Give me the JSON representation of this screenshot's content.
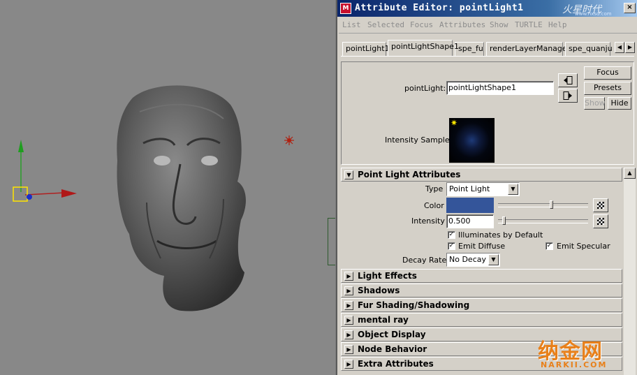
{
  "window": {
    "title": "Attribute Editor: pointLight1",
    "watermark_top": "火星时代",
    "watermark_top_sub": "www.hxsd.com",
    "close_label": "×"
  },
  "menu": [
    "List",
    "Selected",
    "Focus",
    "Attributes",
    "Show",
    "TURTLE",
    "Help"
  ],
  "tabs": [
    "pointLight1",
    "pointLightShape1",
    "spe_fu",
    "renderLayerManager",
    "spe_quanju"
  ],
  "active_tab": "pointLightShape1",
  "tab_scroll": {
    "left": "◀",
    "right": "▶"
  },
  "header": {
    "node_label": "pointLight:",
    "node_value": "pointLightShape1",
    "buttons": {
      "focus": "Focus",
      "presets": "Presets",
      "show": "Show",
      "hide": "Hide"
    },
    "sample_label": "Intensity Sample"
  },
  "sections": {
    "point_light": "Point Light Attributes",
    "light_effects": "Light Effects",
    "shadows": "Shadows",
    "fur": "Fur Shading/Shadowing",
    "mental_ray": "mental ray",
    "object_display": "Object Display",
    "node_behavior": "Node Behavior",
    "extra": "Extra Attributes"
  },
  "point_light": {
    "type_label": "Type",
    "type_value": "Point Light",
    "color_label": "Color",
    "color_hex": "#34559a",
    "color_slider_fraction": 0.6,
    "intensity_label": "Intensity",
    "intensity_value": "0.500",
    "intensity_slider_fraction": 0.05,
    "illuminates_label": "Illuminates by Default",
    "illuminates_checked": true,
    "emit_diffuse_label": "Emit Diffuse",
    "emit_diffuse_checked": true,
    "emit_specular_label": "Emit Specular",
    "emit_specular_checked": true,
    "decay_label": "Decay Rate",
    "decay_value": "No Decay"
  },
  "watermark_bottom": {
    "cn": "纳金网",
    "en": "NARKII.COM"
  }
}
